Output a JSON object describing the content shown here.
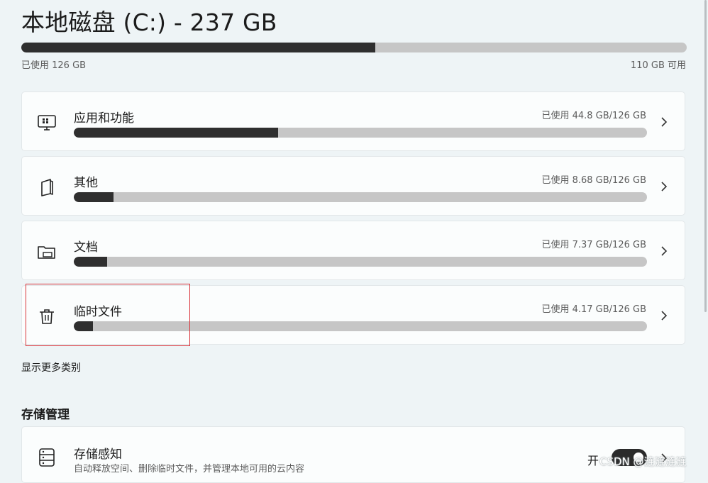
{
  "header": {
    "title": "本地磁盘 (C:) - 237 GB",
    "used_label": "已使用 126 GB",
    "free_label": "110 GB 可用",
    "used_fraction": 0.532
  },
  "categories": [
    {
      "icon": "apps-icon",
      "label": "应用和功能",
      "usage": "已使用 44.8 GB/126 GB",
      "fraction": 0.356
    },
    {
      "icon": "other-icon",
      "label": "其他",
      "usage": "已使用 8.68 GB/126 GB",
      "fraction": 0.069
    },
    {
      "icon": "folder-icon",
      "label": "文档",
      "usage": "已使用 7.37 GB/126 GB",
      "fraction": 0.058
    },
    {
      "icon": "trash-icon",
      "label": "临时文件",
      "usage": "已使用 4.17 GB/126 GB",
      "fraction": 0.033
    }
  ],
  "show_more": "显示更多类别",
  "storage_management": {
    "title": "存储管理",
    "storage_sense": {
      "label": "存储感知",
      "description": "自动释放空间、删除临时文件，并管理本地可用的云内容",
      "state": "开"
    }
  },
  "watermark": "CSDN @涟涟涟涟",
  "colors": {
    "bar_fill": "#2f2f2f",
    "bar_track": "#c6c6c6",
    "highlight": "#d9343a"
  }
}
